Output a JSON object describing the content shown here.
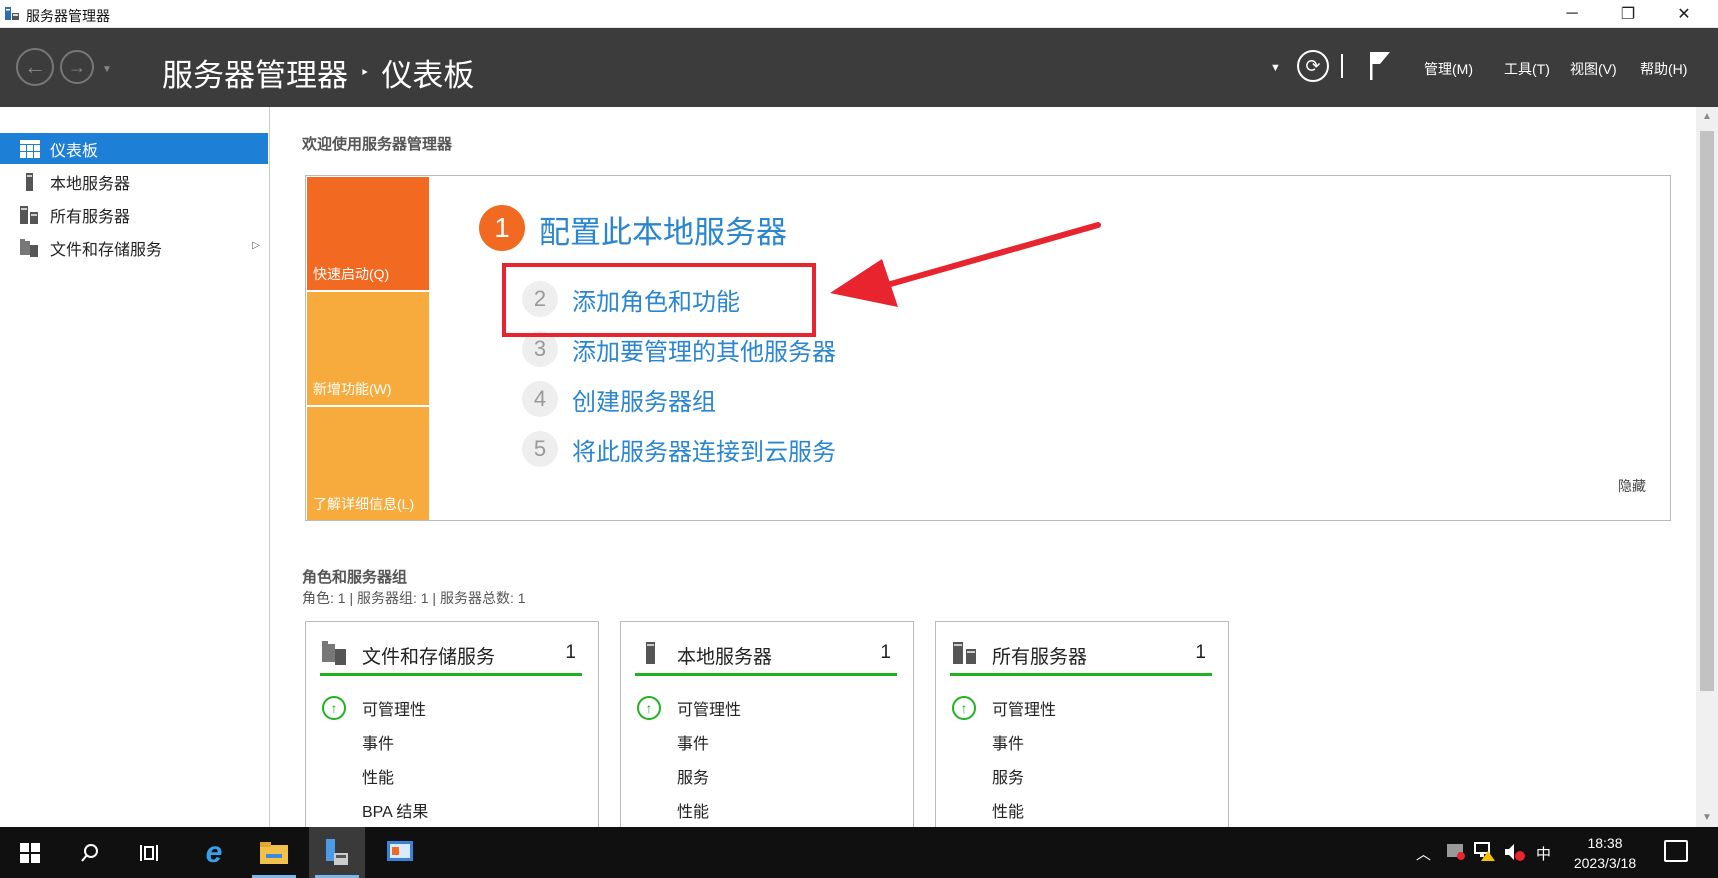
{
  "window": {
    "title": "服务器管理器",
    "minimize": "─",
    "maximize": "❐",
    "close": "✕"
  },
  "header": {
    "breadcrumb_root": "服务器管理器",
    "breadcrumb_sep": "‣",
    "breadcrumb_current": "仪表板",
    "menus": [
      "管理(M)",
      "工具(T)",
      "视图(V)",
      "帮助(H)"
    ]
  },
  "sidebar": {
    "items": [
      {
        "label": "仪表板",
        "icon": "dashboard-icon",
        "active": true
      },
      {
        "label": "本地服务器",
        "icon": "server-icon",
        "active": false
      },
      {
        "label": "所有服务器",
        "icon": "servers-icon",
        "active": false
      },
      {
        "label": "文件和存储服务",
        "icon": "file-storage-icon",
        "active": false
      }
    ]
  },
  "main": {
    "welcome": "欢迎使用服务器管理器",
    "quickstart": {
      "tiles": [
        {
          "label": "快速启动(Q)",
          "color": "#f26a21"
        },
        {
          "label": "新增功能(W)",
          "color": "#f7ab3c"
        },
        {
          "label": "了解详细信息(L)",
          "color": "#f7ab3c"
        }
      ],
      "step1": {
        "num": "1",
        "label": "配置此本地服务器"
      },
      "steps": [
        {
          "num": "2",
          "label": "添加角色和功能"
        },
        {
          "num": "3",
          "label": "添加要管理的其他服务器"
        },
        {
          "num": "4",
          "label": "创建服务器组"
        },
        {
          "num": "5",
          "label": "将此服务器连接到云服务"
        }
      ],
      "hide": "隐藏"
    },
    "roles": {
      "title": "角色和服务器组",
      "subtitle": "角色: 1 | 服务器组: 1 | 服务器总数: 1",
      "cards": [
        {
          "title": "文件和存储服务",
          "count": "1",
          "rows": [
            "可管理性",
            "事件",
            "性能",
            "BPA 结果"
          ]
        },
        {
          "title": "本地服务器",
          "count": "1",
          "rows": [
            "可管理性",
            "事件",
            "服务",
            "性能"
          ]
        },
        {
          "title": "所有服务器",
          "count": "1",
          "rows": [
            "可管理性",
            "事件",
            "服务",
            "性能"
          ]
        }
      ]
    }
  },
  "taskbar": {
    "ime": "中",
    "time": "18:38",
    "date": "2023/3/18"
  },
  "colors": {
    "accent": "#1e7fd6",
    "link": "#2a86cf",
    "ok": "#1fb21f",
    "annotation": "#e8242f"
  }
}
